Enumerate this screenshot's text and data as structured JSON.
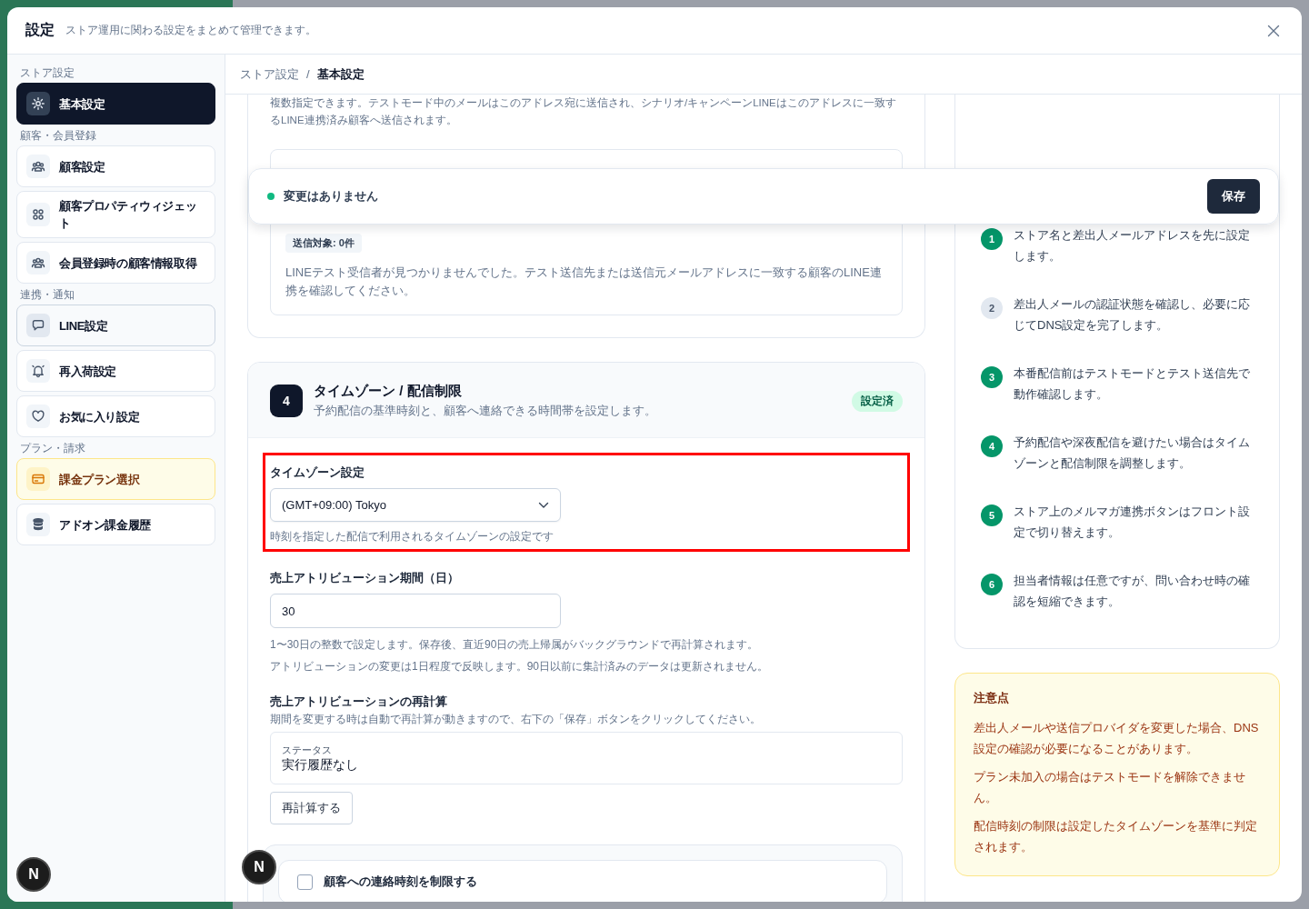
{
  "dialog": {
    "title": "設定",
    "subtitle": "ストア運用に関わる設定をまとめて管理できます。"
  },
  "sidebar": {
    "groups": [
      {
        "label": "ストア設定",
        "items": [
          {
            "label": "基本設定",
            "selected": true,
            "kind": "plain"
          }
        ]
      },
      {
        "label": "顧客・会員登録",
        "items": [
          {
            "label": "顧客設定",
            "selected": false,
            "kind": "plain"
          },
          {
            "label": "顧客プロパティウィジェット",
            "selected": false,
            "kind": "plain"
          },
          {
            "label": "会員登録時の顧客情報取得",
            "selected": false,
            "kind": "plain"
          }
        ]
      },
      {
        "label": "連携・通知",
        "items": [
          {
            "label": "LINE設定",
            "selected": false,
            "kind": "hover"
          },
          {
            "label": "再入荷設定",
            "selected": false,
            "kind": "plain"
          },
          {
            "label": "お気に入り設定",
            "selected": false,
            "kind": "plain"
          }
        ]
      },
      {
        "label": "プラン・請求",
        "items": [
          {
            "label": "課金プラン選択",
            "selected": false,
            "kind": "plan"
          },
          {
            "label": "アドオン課金履歴",
            "selected": false,
            "kind": "plain"
          }
        ]
      }
    ]
  },
  "breadcrumb": {
    "items": [
      "ストア設定",
      "基本設定"
    ],
    "separator": "/"
  },
  "previous_section": {
    "description": "複数指定できます。テストモード中のメールはこのアドレス宛に送信され、シナリオ/キャンペーンLINEはこのアドレスに一致するLINE連携済み顧客へ送信されます。",
    "recipients": {
      "count_badge": "送信対象: 0件",
      "message": "LINEテスト受信者が見つかりませんでした。テスト送信先または送信元メールアドレスに一致する顧客のLINE連携を確認してください。"
    }
  },
  "section": {
    "number": "4",
    "title": "タイムゾーン / 配信制限",
    "description": "予約配信の基準時刻と、顧客へ連絡できる時間帯を設定します。",
    "status_badge": "設定済",
    "timezone": {
      "label": "タイムゾーン設定",
      "value": "(GMT+09:00) Tokyo",
      "hint": "時刻を指定した配信で利用されるタイムゾーンの設定です",
      "highlighted": true
    },
    "attribution_period": {
      "label": "売上アトリビューション期間（日）",
      "value": "30",
      "hints": [
        "1〜30日の整数で設定します。保存後、直近90日の売上帰属がバックグラウンドで再計算されます。",
        "アトリビューションの変更は1日程度で反映します。90日以前に集計済みのデータは更新されません。"
      ]
    },
    "recalculation": {
      "title": "売上アトリビューションの再計算",
      "description": "期間を変更する時は自動で再計算が動きますので、右下の「保存」ボタンをクリックしてください。",
      "status_label": "ステータス",
      "status_value": "実行履歴なし",
      "button": "再計算する"
    },
    "contact_limit": {
      "label": "顧客への連絡時刻を制限する",
      "checked": false
    }
  },
  "toast": {
    "message": "変更はありません",
    "save_button": "保存"
  },
  "steps": [
    {
      "number": "1",
      "text": "ストア名と差出人メールアドレスを先に設定します。",
      "done": true
    },
    {
      "number": "2",
      "text": "差出人メールの認証状態を確認し、必要に応じてDNS設定を完了します。",
      "done": false
    },
    {
      "number": "3",
      "text": "本番配信前はテストモードとテスト送信先で動作確認します。",
      "done": true
    },
    {
      "number": "4",
      "text": "予約配信や深夜配信を避けたい場合はタイムゾーンと配信制限を調整します。",
      "done": true
    },
    {
      "number": "5",
      "text": "ストア上のメルマガ連携ボタンはフロント設定で切り替えます。",
      "done": true
    },
    {
      "number": "6",
      "text": "担当者情報は任意ですが、問い合わせ時の確認を短縮できます。",
      "done": true
    }
  ],
  "notice": {
    "title": "注意点",
    "items": [
      "差出人メールや送信プロバイダを変更した場合、DNS設定の確認が必要になることがあります。",
      "プラン未加入の場合はテストモードを解除できません。",
      "配信時刻の制限は設定したタイムゾーンを基準に判定されます。"
    ]
  },
  "dev_badges": [
    "N",
    "N"
  ]
}
